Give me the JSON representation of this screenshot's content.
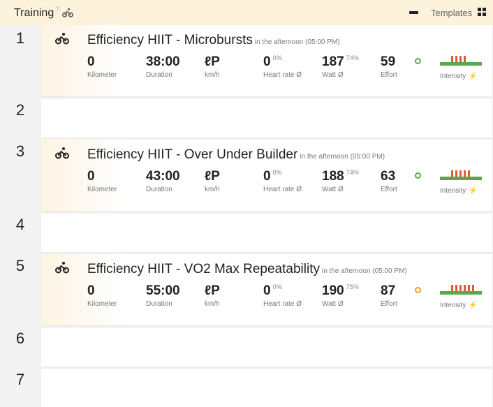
{
  "header": {
    "title": "Training",
    "help": "?",
    "templates_label": "Templates"
  },
  "days": [
    {
      "num": "1"
    },
    {
      "num": "2"
    },
    {
      "num": "3"
    },
    {
      "num": "4"
    },
    {
      "num": "5"
    },
    {
      "num": "6"
    },
    {
      "num": "7"
    }
  ],
  "workouts": [
    {
      "title": "Efficiency HIIT - Microbursts",
      "time": "in the afternoon (05:00 PM)",
      "distance": "0",
      "distance_label": "Kilometer",
      "duration": "38:00",
      "duration_label": "Duration",
      "speed": "ℓP",
      "speed_label": "km/h",
      "hr": "0",
      "hr_pct": "0%",
      "hr_label": "Heart rate Ø",
      "watt": "187",
      "watt_pct": "74%",
      "watt_label": "Watt Ø",
      "effort": "59",
      "effort_label": "Effort",
      "effort_color": "#5aa84a",
      "intensity_label": "Intensity",
      "intensity_bars": [
        0.9,
        0.9,
        0.9,
        0.9
      ]
    },
    {
      "title": "Efficiency HIIT - Over Under Builder",
      "time": "in the afternoon (05:00 PM)",
      "distance": "0",
      "distance_label": "Kilometer",
      "duration": "43:00",
      "duration_label": "Duration",
      "speed": "ℓP",
      "speed_label": "km/h",
      "hr": "0",
      "hr_pct": "0%",
      "hr_label": "Heart rate Ø",
      "watt": "188",
      "watt_pct": "74%",
      "watt_label": "Watt Ø",
      "effort": "63",
      "effort_label": "Effort",
      "effort_color": "#5aa84a",
      "intensity_label": "Intensity",
      "intensity_bars": [
        0.9,
        0.9,
        0.9,
        0.9,
        0.9
      ]
    },
    {
      "title": "Efficiency HIIT - VO2 Max Repeatability",
      "time": "in the afternoon (05:00 PM)",
      "distance": "0",
      "distance_label": "Kilometer",
      "duration": "55:00",
      "duration_label": "Duration",
      "speed": "ℓP",
      "speed_label": "km/h",
      "hr": "0",
      "hr_pct": "0%",
      "hr_label": "Heart rate Ø",
      "watt": "190",
      "watt_pct": "75%",
      "watt_label": "Watt Ø",
      "effort": "87",
      "effort_label": "Effort",
      "effort_color": "#f0a020",
      "intensity_label": "Intensity",
      "intensity_bars": [
        0.9,
        0.9,
        0.9,
        0.9,
        0.9,
        0.9
      ]
    }
  ]
}
